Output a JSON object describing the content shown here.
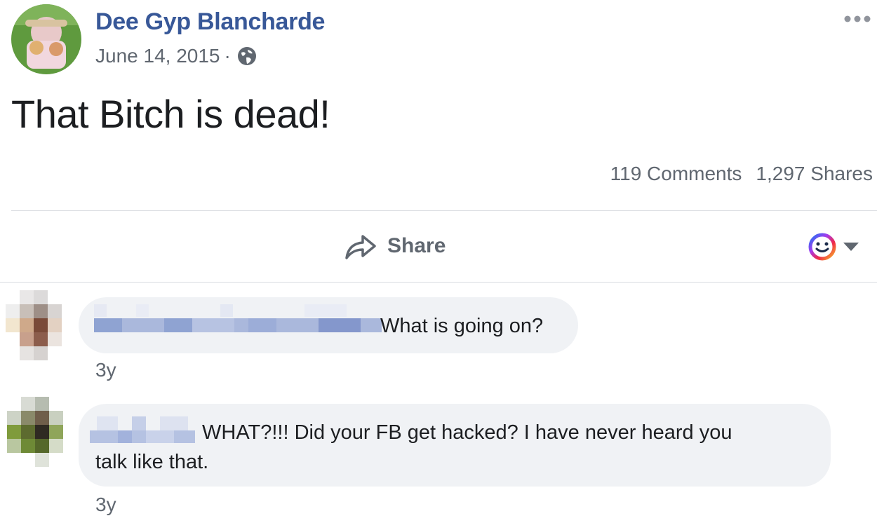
{
  "post": {
    "author": "Dee Gyp Blancharde",
    "date": "June 14, 2015",
    "separator": "·",
    "privacy_icon": "globe-icon",
    "more_icon": "more-options-icon",
    "text": "That Bitch is dead!",
    "comments_count": "119 Comments",
    "shares_count": "1,297 Shares"
  },
  "actions": {
    "share_label": "Share",
    "share_icon": "share-arrow-icon",
    "reaction_icon": "smiley-icon",
    "reaction_caret": "caret-down-icon"
  },
  "comments": [
    {
      "author": "",
      "text": "What is going on?",
      "time": "3y"
    },
    {
      "author": "",
      "text_line1": "WHAT?!!! Did your FB get hacked? I have never heard you",
      "text_line2": "talk like that.",
      "time": "3y"
    }
  ],
  "colors": {
    "name_blue": "#385898",
    "meta_gray": "#606770",
    "bubble_bg": "#f0f2f5",
    "divider": "#dadde1"
  }
}
